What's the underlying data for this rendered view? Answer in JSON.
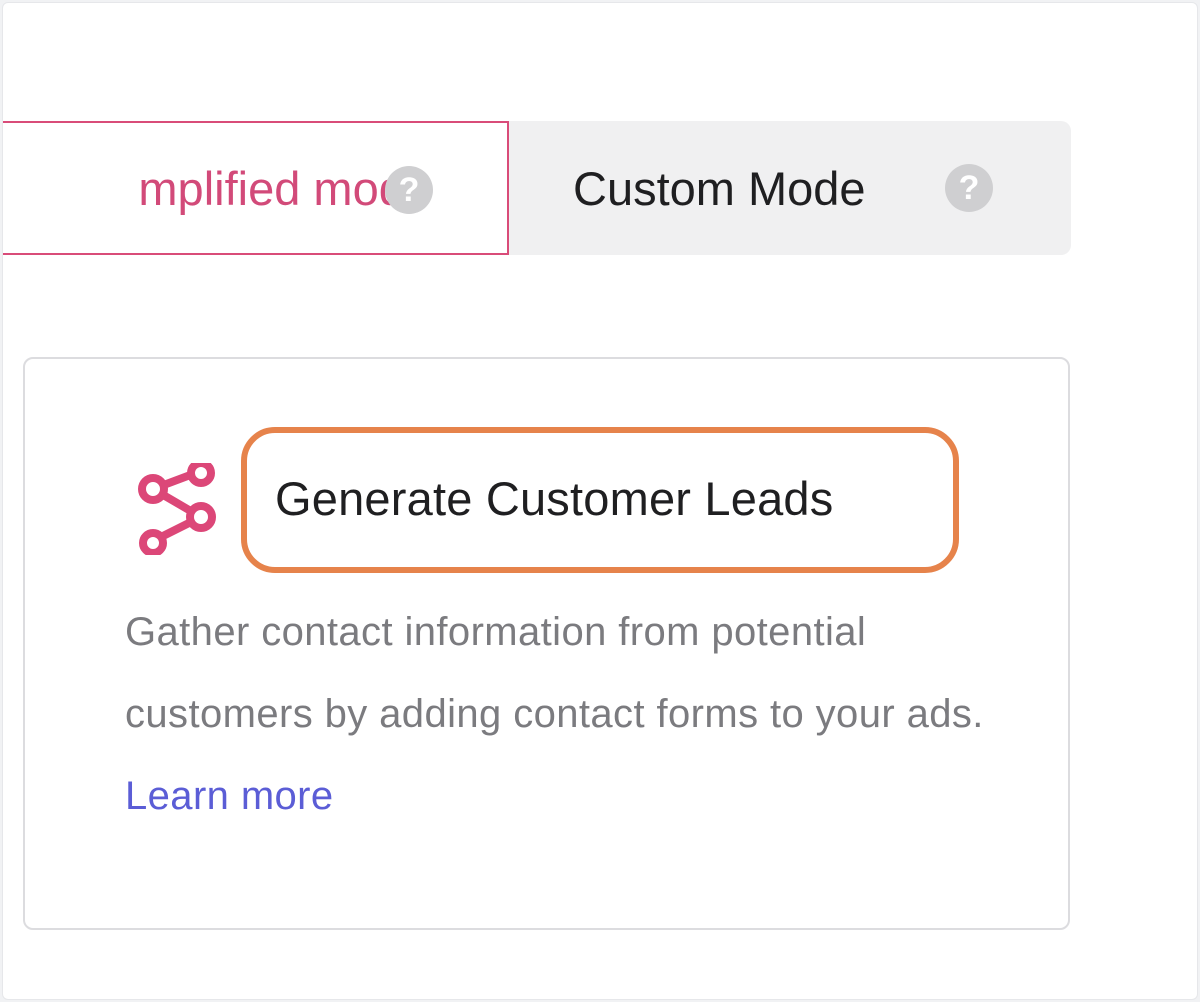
{
  "mode_toggle": {
    "simplified": {
      "label": "mplified mode",
      "help": "?"
    },
    "custom": {
      "label": "Custom Mode",
      "help": "?"
    }
  },
  "objective": {
    "icon": "share-nodes-icon",
    "title": "Generate Customer Leads",
    "description": "Gather contact information from potential customers by adding contact forms to your ads.",
    "learn_more": "Learn more"
  },
  "colors": {
    "accent_pink": "#d24a79",
    "highlight_orange": "#e6834b",
    "link_blue": "#5b5dd6"
  }
}
